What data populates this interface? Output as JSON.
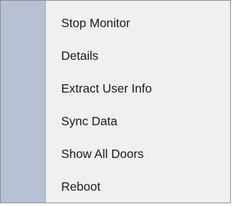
{
  "context_menu": {
    "items": [
      {
        "label": "Stop Monitor"
      },
      {
        "label": "Details"
      },
      {
        "label": "Extract User Info"
      },
      {
        "label": "Sync Data"
      },
      {
        "label": "Show All Doors"
      },
      {
        "label": "Reboot"
      }
    ]
  }
}
